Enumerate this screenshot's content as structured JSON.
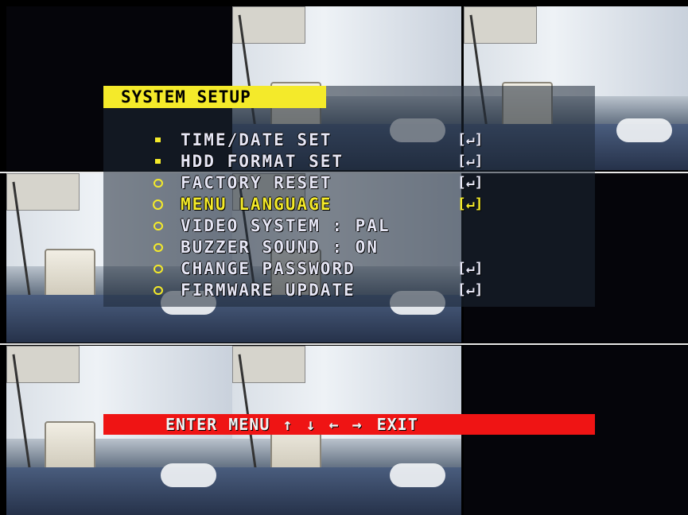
{
  "title": "SYSTEM SETUP",
  "menu": {
    "items": [
      {
        "label": "TIME/DATE SET",
        "enter": "[↵]"
      },
      {
        "label": "HDD FORMAT SET",
        "enter": "[↵]"
      },
      {
        "label": "FACTORY RESET",
        "enter": "[↵]"
      },
      {
        "label": "MENU LANGUAGE",
        "enter": "[↵]"
      },
      {
        "label": "VIDEO SYSTEM : PAL",
        "enter": ""
      },
      {
        "label": "BUZZER SOUND : ON",
        "enter": ""
      },
      {
        "label": "CHANGE PASSWORD",
        "enter": "[↵]"
      },
      {
        "label": "FIRMWARE UPDATE",
        "enter": "[↵]"
      }
    ],
    "selected": "MENU LANGUAGE"
  },
  "nav": {
    "enter": "ENTER",
    "menu": "MENU",
    "up": "↑",
    "down": "↓",
    "left": "←",
    "right": "→",
    "exit": "EXIT"
  },
  "colors": {
    "accent": "#f4ea2a",
    "nav_bar": "#ef1414"
  }
}
